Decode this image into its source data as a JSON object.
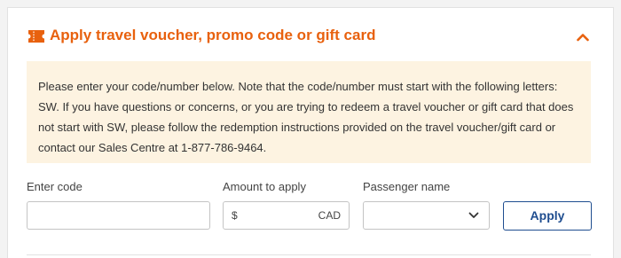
{
  "colors": {
    "accent": "#e8610e",
    "notice_background": "#fdf3e1",
    "button_blue": "#1f4d8f"
  },
  "header": {
    "icon": "voucher-ticket-icon",
    "title": "Apply travel voucher, promo code or gift card",
    "toggle_icon": "chevron-up-icon"
  },
  "notice": {
    "text": "Please enter your code/number below. Note that the code/number must start with the following letters: SW. If you have questions or concerns, or you are trying to redeem a travel voucher or gift card that does not start with SW, please follow the redemption instructions provided on the travel voucher/gift card or contact our Sales Centre at 1-877-786-9464."
  },
  "form": {
    "code": {
      "label": "Enter code",
      "value": "",
      "placeholder": ""
    },
    "amount": {
      "label": "Amount to apply",
      "prefix": "$",
      "suffix": "CAD",
      "value": ""
    },
    "passenger": {
      "label": "Passenger name",
      "selected": "",
      "icon": "chevron-down-icon"
    },
    "apply_label": "Apply"
  }
}
